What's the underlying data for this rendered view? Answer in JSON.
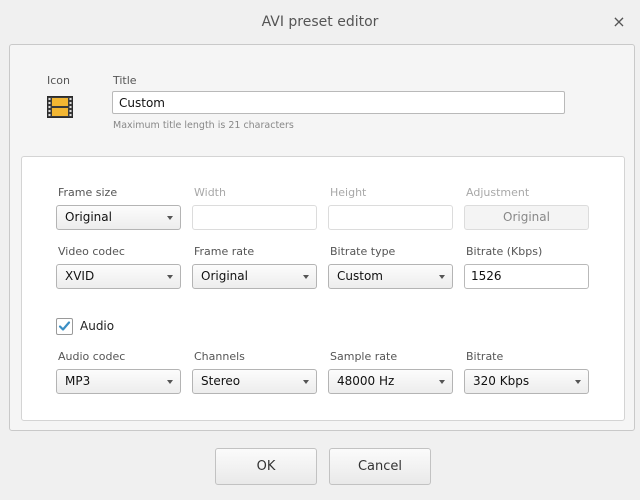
{
  "window": {
    "title": "AVI preset editor",
    "close_glyph": "×"
  },
  "header": {
    "icon_label": "Icon",
    "icon_name": "film-strip-icon",
    "title_label": "Title",
    "title_value": "Custom",
    "title_hint": "Maximum title length is 21 characters"
  },
  "video": {
    "frame_size": {
      "label": "Frame size",
      "value": "Original"
    },
    "width": {
      "label": "Width",
      "value": ""
    },
    "height": {
      "label": "Height",
      "value": ""
    },
    "adjustment": {
      "label": "Adjustment",
      "value": "Original"
    },
    "video_codec": {
      "label": "Video codec",
      "value": "XVID"
    },
    "frame_rate": {
      "label": "Frame rate",
      "value": "Original"
    },
    "bitrate_type": {
      "label": "Bitrate type",
      "value": "Custom"
    },
    "bitrate": {
      "label": "Bitrate (Kbps)",
      "value": "1526"
    }
  },
  "audio": {
    "enabled_label": "Audio",
    "enabled": true,
    "codec": {
      "label": "Audio codec",
      "value": "MP3"
    },
    "channels": {
      "label": "Channels",
      "value": "Stereo"
    },
    "sample_rate": {
      "label": "Sample rate",
      "value": "48000 Hz"
    },
    "bitrate": {
      "label": "Bitrate",
      "value": "320 Kbps"
    }
  },
  "footer": {
    "ok_label": "OK",
    "cancel_label": "Cancel"
  },
  "colors": {
    "accent_check": "#3b8fc4"
  }
}
